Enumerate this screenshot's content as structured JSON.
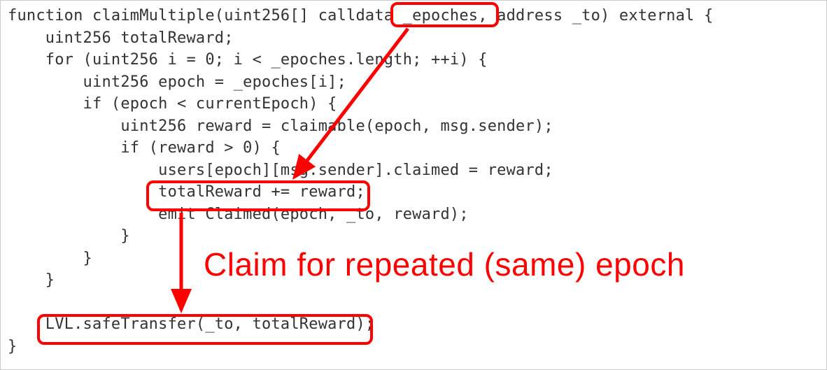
{
  "code": {
    "l01": "function claimMultiple(uint256[] calldata _epoches, address _to) external {",
    "l02": "    uint256 totalReward;",
    "l03": "    for (uint256 i = 0; i < _epoches.length; ++i) {",
    "l04": "        uint256 epoch = _epoches[i];",
    "l05": "        if (epoch < currentEpoch) {",
    "l06": "            uint256 reward = claimable(epoch, msg.sender);",
    "l07": "            if (reward > 0) {",
    "l08": "                users[epoch][msg.sender].claimed = reward;",
    "l09": "                totalReward += reward;",
    "l10": "                emit Claimed(epoch, _to, reward);",
    "l11": "            }",
    "l12": "        }",
    "l13": "    }",
    "l14": "",
    "l15": "    LVL.safeTransfer(_to, totalReward);",
    "l16": "}"
  },
  "annotation": {
    "label": "Claim for repeated (same) epoch"
  },
  "highlights": {
    "box_epoches": "_epoches,",
    "box_total_reward_line": "totalReward += reward;",
    "box_transfer_line": "LVL.safeTransfer(_to, totalReward);"
  },
  "colors": {
    "annotation_red": "#ff0000",
    "code_text": "#333333",
    "border": "#cccccc"
  }
}
